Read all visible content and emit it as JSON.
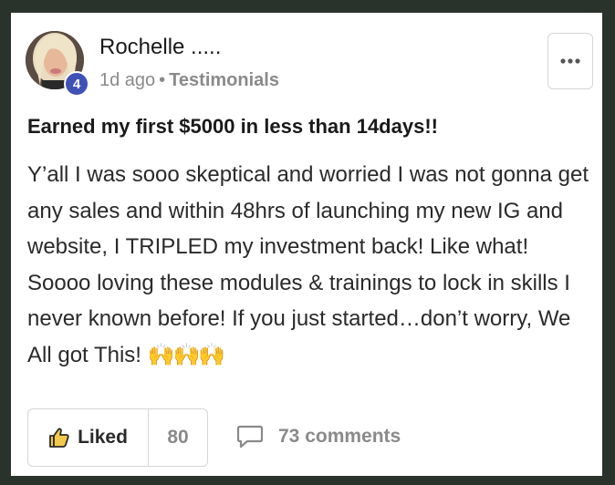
{
  "post": {
    "author": "Rochelle .....",
    "level": "4",
    "time": "1d ago",
    "separator": "•",
    "category": "Testimonials",
    "title": "Earned my first $5000 in less than 14days!!",
    "body": "Y’all I was sooo skeptical and worried I was not gonna get any sales and within 48hrs of launching my new IG and website, I TRIPLED my investment back! Like what! Soooo loving these modules & trainings to lock in skills I never known before! If you just started…don’t worry, We All got This!",
    "emoji": "🙌🙌🙌"
  },
  "actions": {
    "like_label": "Liked",
    "like_count": "80",
    "comments_label": "73 comments"
  },
  "icons": {
    "more": "more-options-icon",
    "like": "thumbs-up-icon",
    "comment": "comment-bubble-icon"
  },
  "colors": {
    "frame": "#2a322c",
    "card": "#ffffff",
    "level_badge": "#3f51b5",
    "muted_text": "#8a8a8a",
    "border": "#d6d6d6"
  }
}
